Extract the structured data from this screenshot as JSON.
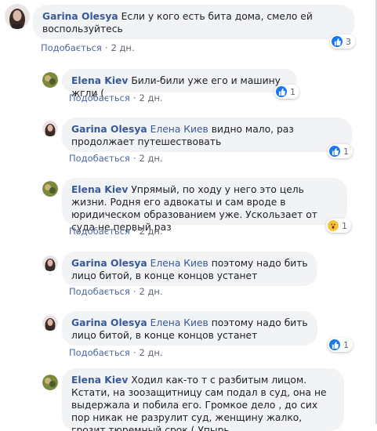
{
  "comments": [
    {
      "author": "Garina Olesya",
      "mention": "",
      "text": "Если у кого есть бита дома, смело ей воспользуйтесь",
      "like_label": "Подобається",
      "time": "2 дн.",
      "reaction_icon": "like-icon",
      "reaction_count": "3"
    },
    {
      "author": "Elena Kiev",
      "mention": "",
      "text": "Били-били уже его и машину жгли (",
      "like_label": "Подобається",
      "time": "2 дн.",
      "reaction_icon": "like-icon",
      "reaction_count": "1"
    },
    {
      "author": "Garina Olesya",
      "mention": "Елена Киев",
      "text": "видно мало, раз продолжает путешествовать",
      "like_label": "Подобається",
      "time": "2 дн.",
      "reaction_icon": "like-icon",
      "reaction_count": "1"
    },
    {
      "author": "Elena Kiev",
      "mention": "",
      "text": "Упрямый, по ходу у него это цель жизни. Родня его адвокаты и сам вроде в юридическом образованием уже. Ускользает от суда не первый раз",
      "like_label": "Подобається",
      "time": "2 дн.",
      "reaction_icon": "wow-icon",
      "reaction_count": "1"
    },
    {
      "author": "Garina Olesya",
      "mention": "Елена Киев",
      "text": "поэтому надо бить лицо битой, в конце концов устанет",
      "like_label": "Подобається",
      "time": "2 дн.",
      "reaction_icon": "",
      "reaction_count": ""
    },
    {
      "author": "Garina Olesya",
      "mention": "Елена Киев",
      "text": "поэтому надо бить лицо битой, в конце концов устанет",
      "like_label": "Подобається",
      "time": "2 дн.",
      "reaction_icon": "like-icon",
      "reaction_count": "1"
    },
    {
      "author": "Elena Kiev",
      "mention": "",
      "text": "Ходил как-то т с разбитым лицом. Кстати, на зоозащитницу сам подал в суд, она не выдержала и побила его. Громкое дело , до сих пор никак не разрулит суд, женщину жалко, грозит тюремный срок ( Упырь",
      "like_label": "",
      "time": "",
      "reaction_icon": "",
      "reaction_count": ""
    }
  ],
  "colors": {
    "author": "#385898",
    "bubble": "#f2f3f5",
    "text": "#1c1e21",
    "meta": "#606770",
    "like": "#4b67a1",
    "like_badge": "#1877f2",
    "wow_badge": "#f7c13f"
  }
}
